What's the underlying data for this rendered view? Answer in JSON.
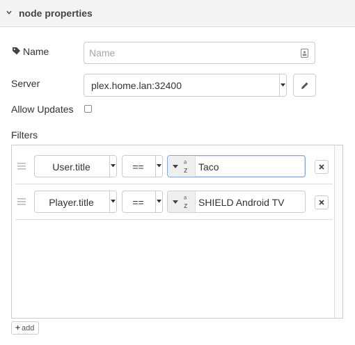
{
  "header": {
    "title": "node properties",
    "icon": "chevron-down-icon"
  },
  "form": {
    "name": {
      "label": "Name",
      "value": "",
      "placeholder": "Name",
      "icon": "tag-icon"
    },
    "server": {
      "label": "Server",
      "value": "plex.home.lan:32400",
      "edit_icon": "pencil-icon"
    },
    "allow_updates": {
      "label": "Allow Updates",
      "checked": false
    },
    "filters": {
      "label": "Filters",
      "rows": [
        {
          "property": "User.title",
          "operator": "==",
          "type_icon": "az",
          "value": "Taco"
        },
        {
          "property": "Player.title",
          "operator": "==",
          "type_icon": "az",
          "value": "SHIELD Android TV"
        }
      ],
      "add_label": "add"
    }
  },
  "colors": {
    "header_bg": "#f3f3f3",
    "border": "#cccccc",
    "focus_border": "#85a8d9"
  }
}
